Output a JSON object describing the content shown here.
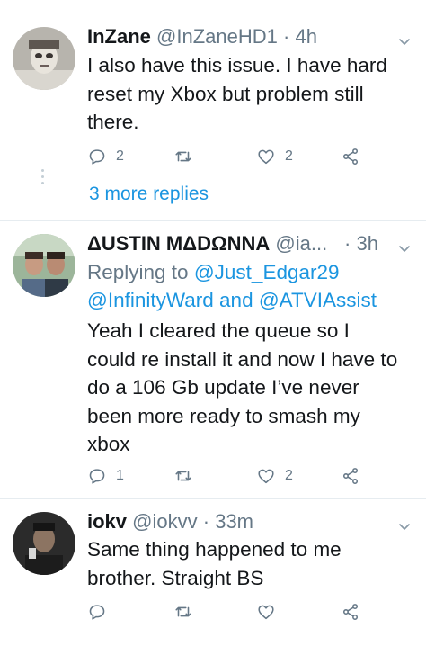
{
  "tweets": [
    {
      "name": "InZane",
      "handle": "@InZaneHD1",
      "sep": "·",
      "time": "4h",
      "text_lines": [
        "I also have this issue. I have hard",
        "reset my Xbox but problem still",
        "there."
      ],
      "reply_count": "2",
      "retweet_count": "",
      "like_count": "2"
    },
    {
      "name": "ΔUSTIN MΔDΩNNA",
      "handle": "@ia...",
      "sep": "·",
      "time": "3h",
      "replying_prefix": "Replying to ",
      "replying_to_1": "@Just_Edgar29",
      "replying_to_2": "@InfinityWard",
      "replying_and": " and ",
      "replying_to_3": "@ATVIAssist",
      "text_lines": [
        "Yeah I cleared the queue so I",
        "could re install it and now I have to",
        "do a 106 Gb update I’ve never",
        "been more ready to smash my",
        "xbox"
      ],
      "reply_count": "1",
      "retweet_count": "",
      "like_count": "2"
    },
    {
      "name": "iokv",
      "handle": "@iokvv",
      "sep": "·",
      "time": "33m",
      "text_lines": [
        "Same thing happened to me",
        "brother. Straight BS"
      ],
      "reply_count": "",
      "retweet_count": "",
      "like_count": ""
    }
  ],
  "more_replies_label": "3 more replies",
  "icons": {
    "reply": "reply-icon",
    "retweet": "retweet-icon",
    "like": "heart-icon",
    "share": "share-icon",
    "caret": "chevron-down-icon"
  },
  "colors": {
    "link": "#1b95e0",
    "secondary": "#657786",
    "text": "#14171a"
  }
}
